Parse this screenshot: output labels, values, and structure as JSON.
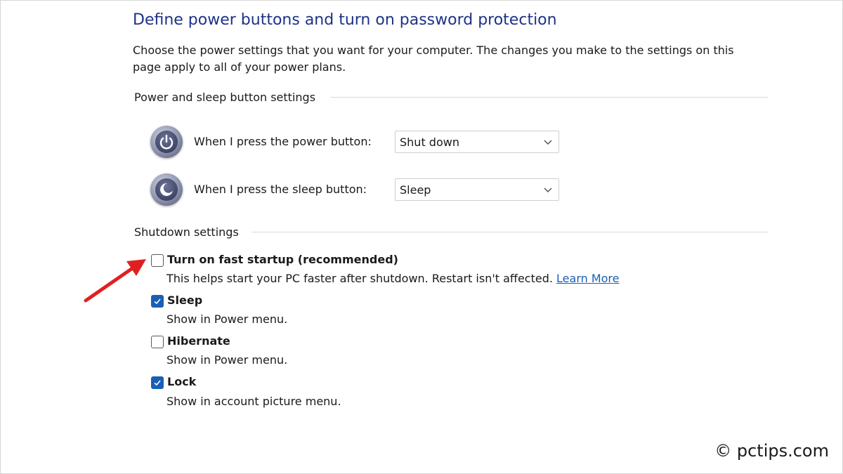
{
  "header": {
    "title": "Define power buttons and turn on password protection",
    "intro": "Choose the power settings that you want for your computer. The changes you make to the settings on this page apply to all of your power plans."
  },
  "power_sleep_group": {
    "heading": "Power and sleep button settings",
    "power_button": {
      "label": "When I press the power button:",
      "value": "Shut down",
      "icon": "power-icon"
    },
    "sleep_button": {
      "label": "When I press the sleep button:",
      "value": "Sleep",
      "icon": "sleep-icon"
    }
  },
  "shutdown_group": {
    "heading": "Shutdown settings",
    "options": [
      {
        "title": "Turn on fast startup (recommended)",
        "description": "This helps start your PC faster after shutdown. Restart isn't affected.",
        "link": "Learn More",
        "checked": false
      },
      {
        "title": "Sleep",
        "description": "Show in Power menu.",
        "checked": true
      },
      {
        "title": "Hibernate",
        "description": "Show in Power menu.",
        "checked": false
      },
      {
        "title": "Lock",
        "description": "Show in account picture menu.",
        "checked": true
      }
    ]
  },
  "annotation": {
    "arrow_color": "#e02020"
  },
  "watermark": "© pctips.com",
  "colors": {
    "title": "#1e3287",
    "link": "#1a5fb4",
    "checkbox_checked": "#1a5fb4"
  }
}
